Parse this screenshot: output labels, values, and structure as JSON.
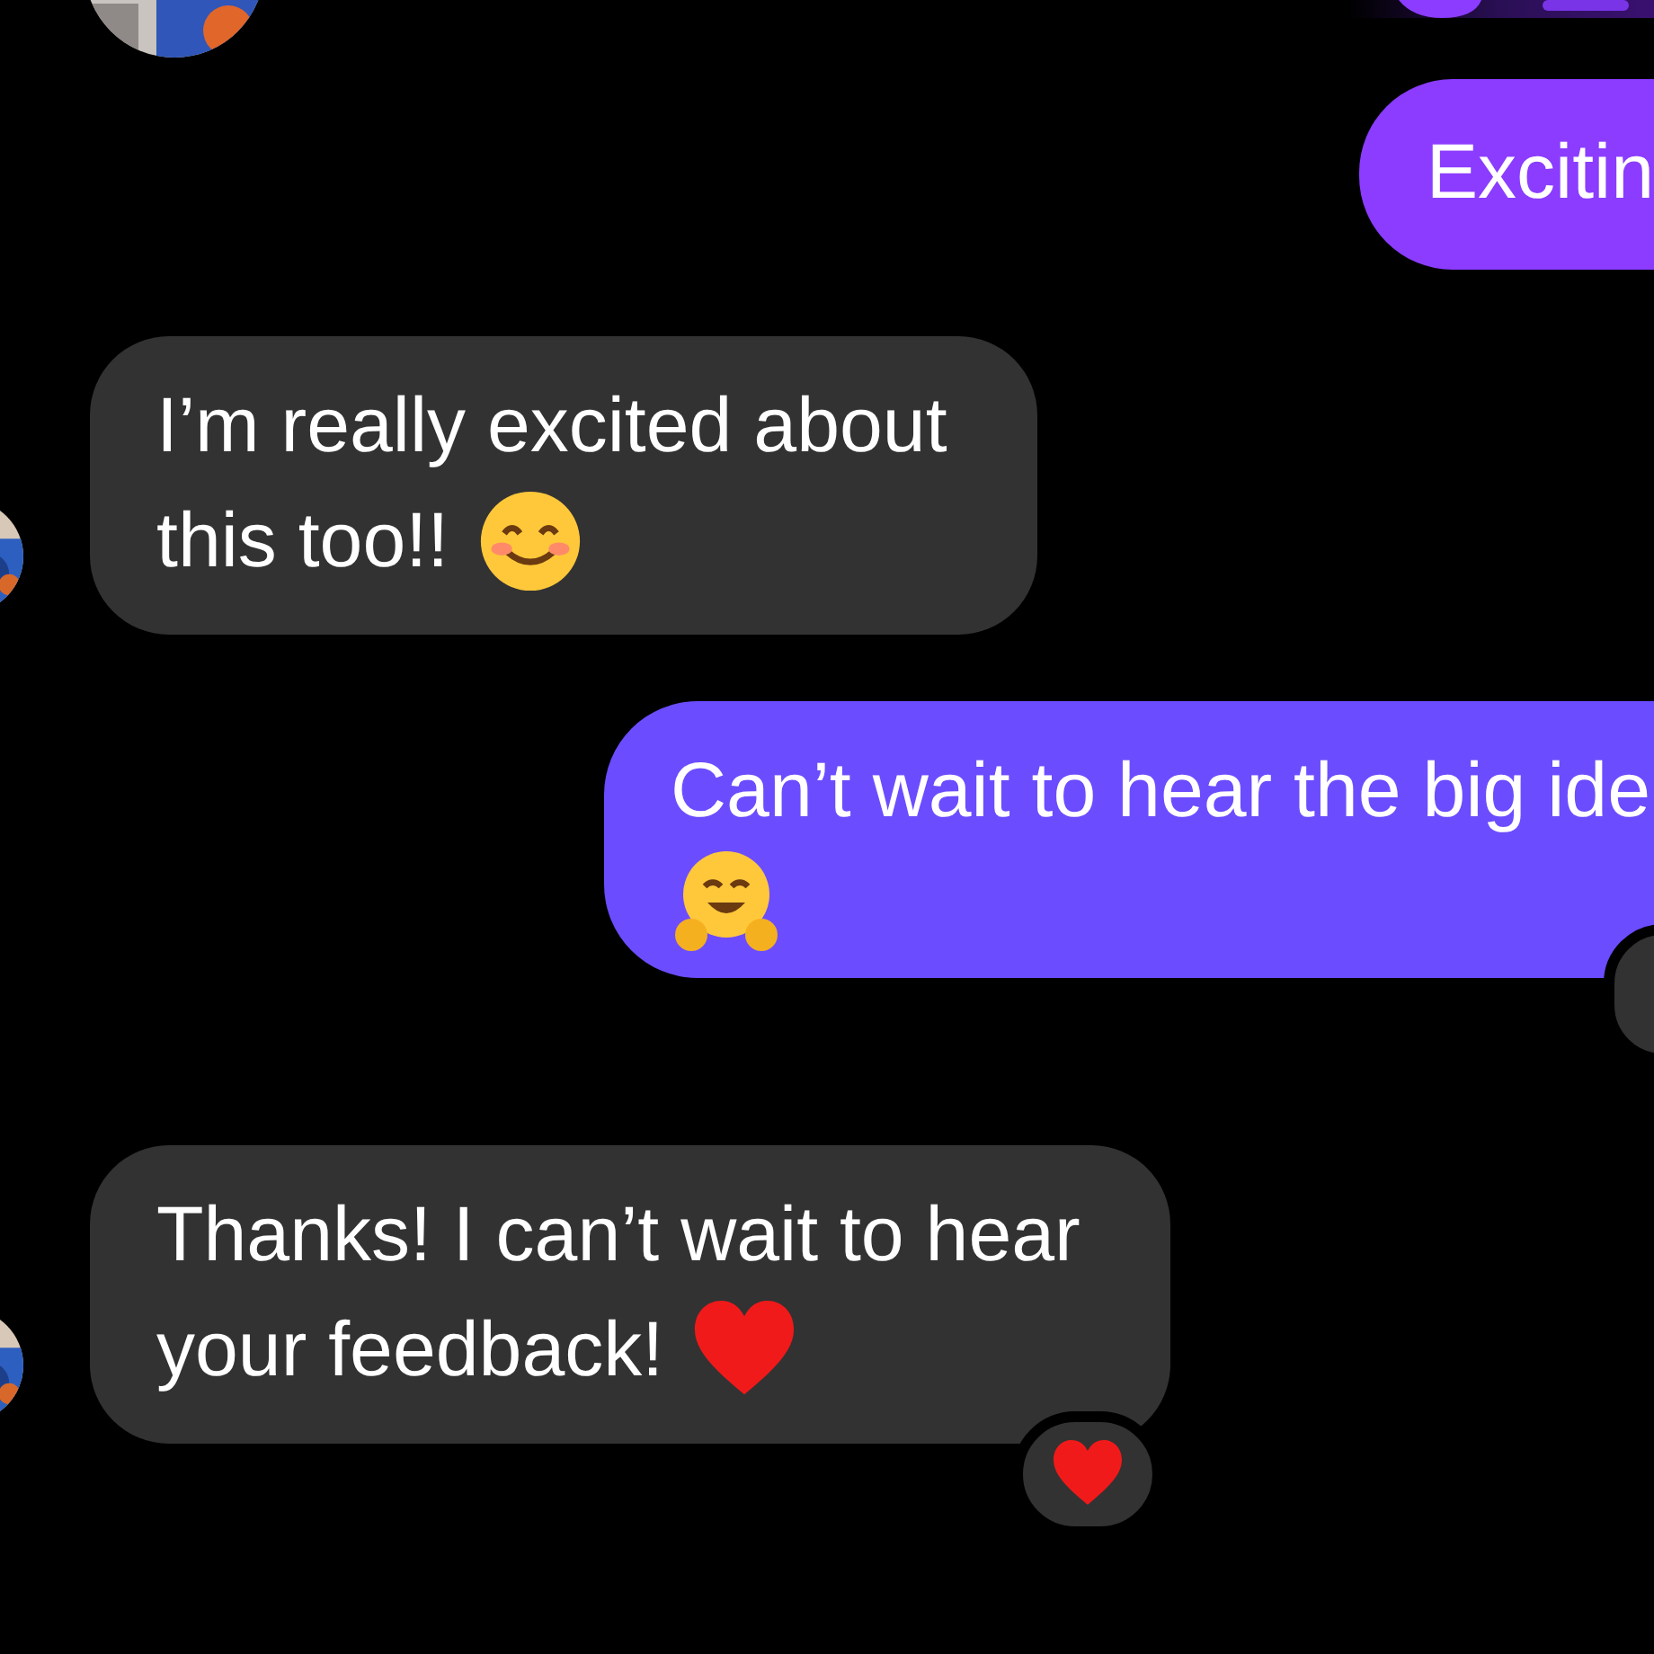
{
  "messages": [
    {
      "kind": "outgoing",
      "color": "#8b3cff",
      "lines": [
        "Excitin"
      ]
    },
    {
      "kind": "incoming",
      "lines": [
        "I’m really excited about",
        "this too!!"
      ],
      "emoji": {
        "kind": "smiling"
      }
    },
    {
      "kind": "outgoing",
      "color": "#6c4cff",
      "lines": [
        "Can’t wait to hear the big ide"
      ],
      "emoji": {
        "kind": "hugging"
      },
      "reaction_peek": true
    },
    {
      "kind": "incoming",
      "lines": [
        "Thanks! I can’t wait to hear",
        "your feedback!"
      ],
      "emoji": {
        "kind": "heart"
      },
      "reaction": {
        "kind": "heart"
      }
    }
  ]
}
